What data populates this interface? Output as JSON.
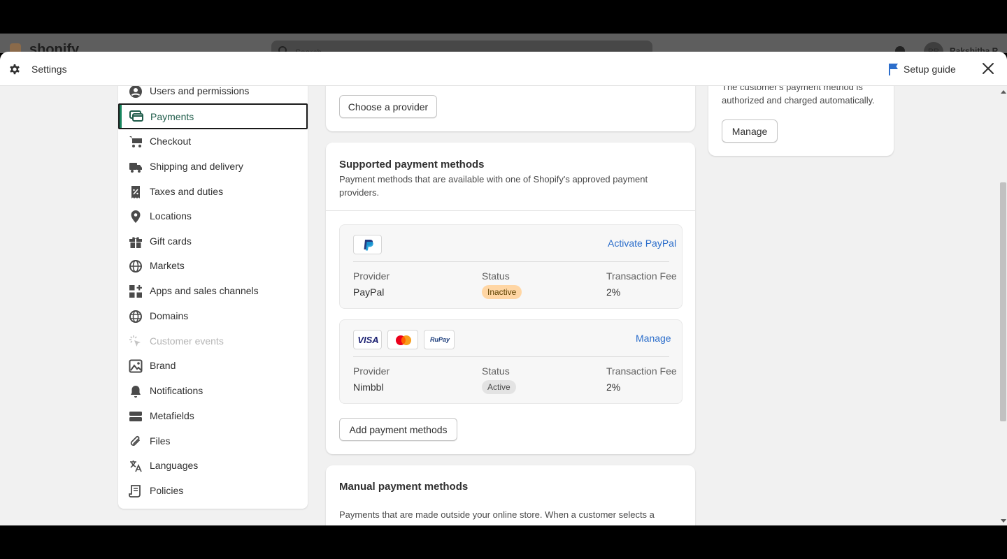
{
  "background_app": {
    "logo_text": "shopify",
    "search_placeholder": "Search",
    "user_initials": "RR",
    "user_name": "Rakshitha R"
  },
  "header": {
    "title": "Settings",
    "setup_guide": "Setup guide",
    "icons": [
      "gear-icon",
      "flag-icon",
      "close-icon"
    ]
  },
  "sidebar": {
    "items": [
      {
        "label": "Users and permissions",
        "icon": "user-circle-icon",
        "state": "normal"
      },
      {
        "label": "Payments",
        "icon": "payments-icon",
        "state": "active"
      },
      {
        "label": "Checkout",
        "icon": "cart-icon",
        "state": "normal"
      },
      {
        "label": "Shipping and delivery",
        "icon": "truck-icon",
        "state": "normal"
      },
      {
        "label": "Taxes and duties",
        "icon": "receipt-icon",
        "state": "normal"
      },
      {
        "label": "Locations",
        "icon": "location-pin-icon",
        "state": "normal"
      },
      {
        "label": "Gift cards",
        "icon": "gift-icon",
        "state": "normal"
      },
      {
        "label": "Markets",
        "icon": "globe-icon",
        "state": "normal"
      },
      {
        "label": "Apps and sales channels",
        "icon": "apps-icon",
        "state": "normal"
      },
      {
        "label": "Domains",
        "icon": "domain-globe-icon",
        "state": "normal"
      },
      {
        "label": "Customer events",
        "icon": "cursor-click-icon",
        "state": "disabled"
      },
      {
        "label": "Brand",
        "icon": "brand-icon",
        "state": "normal"
      },
      {
        "label": "Notifications",
        "icon": "bell-icon",
        "state": "normal"
      },
      {
        "label": "Metafields",
        "icon": "metafields-icon",
        "state": "normal"
      },
      {
        "label": "Files",
        "icon": "paperclip-icon",
        "state": "normal"
      },
      {
        "label": "Languages",
        "icon": "translate-icon",
        "state": "normal"
      },
      {
        "label": "Policies",
        "icon": "policy-icon",
        "state": "normal"
      }
    ]
  },
  "provider_card": {
    "button": "Choose a provider"
  },
  "side_card": {
    "text_line1": "The customer's payment method is",
    "text_line2": "authorized and charged automatically.",
    "button": "Manage"
  },
  "supported": {
    "title": "Supported payment methods",
    "description": "Payment methods that are available with one of Shopify's approved payment providers.",
    "columns": {
      "provider": "Provider",
      "status": "Status",
      "fee": "Transaction Fee"
    },
    "providers": [
      {
        "name": "PayPal",
        "status": "Inactive",
        "fee": "2%",
        "action": "Activate PayPal",
        "logos": [
          "paypal-logo"
        ],
        "status_color": "#ffd6a4"
      },
      {
        "name": "Nimbbl",
        "status": "Active",
        "fee": "2%",
        "action": "Manage",
        "logos": [
          "visa-logo",
          "mastercard-logo",
          "rupay-logo"
        ],
        "logo_text": {
          "visa": "VISA",
          "rupay": "RuPay"
        },
        "status_color": "#e3e3e3"
      }
    ],
    "add_button": "Add payment methods"
  },
  "manual": {
    "title": "Manual payment methods",
    "description": "Payments that are made outside your online store. When a customer selects a"
  },
  "colors": {
    "accent": "#17855e",
    "link": "#2c6ecb",
    "inactive_badge": "#ffd6a4",
    "active_badge": "#e3e3e3"
  }
}
